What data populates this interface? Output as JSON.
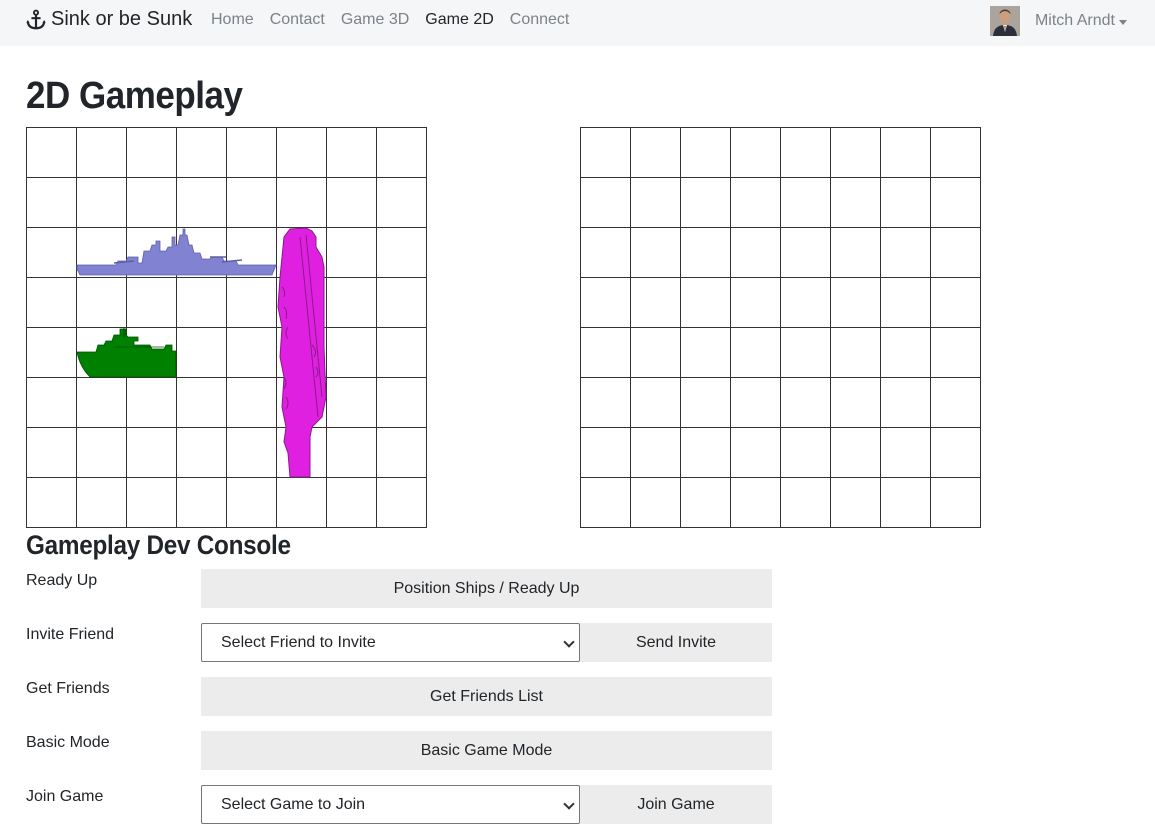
{
  "nav": {
    "brand": "Sink or be Sunk",
    "links": [
      {
        "label": "Home"
      },
      {
        "label": "Contact"
      },
      {
        "label": "Game 3D"
      },
      {
        "label": "Game 2D"
      },
      {
        "label": "Connect"
      }
    ],
    "active": "Game 2D",
    "user_name": "Mitch Arndt"
  },
  "page": {
    "title": "2D Gameplay"
  },
  "boards": {
    "rows": 8,
    "cols": 8,
    "player_ships": [
      {
        "name": "battleship",
        "color": "#8282d2"
      },
      {
        "name": "patrol-boat",
        "color": "#008000"
      },
      {
        "name": "aircraft-carrier",
        "color": "#e020e0"
      }
    ]
  },
  "console": {
    "title": "Gameplay Dev Console",
    "rows": [
      {
        "label": "Ready Up",
        "button": "Position Ships / Ready Up"
      },
      {
        "label": "Invite Friend",
        "select": "Select Friend to Invite",
        "button": "Send Invite"
      },
      {
        "label": "Get Friends",
        "button": "Get Friends List"
      },
      {
        "label": "Basic Mode",
        "button": "Basic Game Mode"
      },
      {
        "label": "Join Game",
        "select": "Select Game to Join",
        "button": "Join Game"
      }
    ]
  },
  "icons": {
    "brand": "anchor-icon",
    "user": "avatar",
    "dropdown": "caret-down-icon"
  }
}
